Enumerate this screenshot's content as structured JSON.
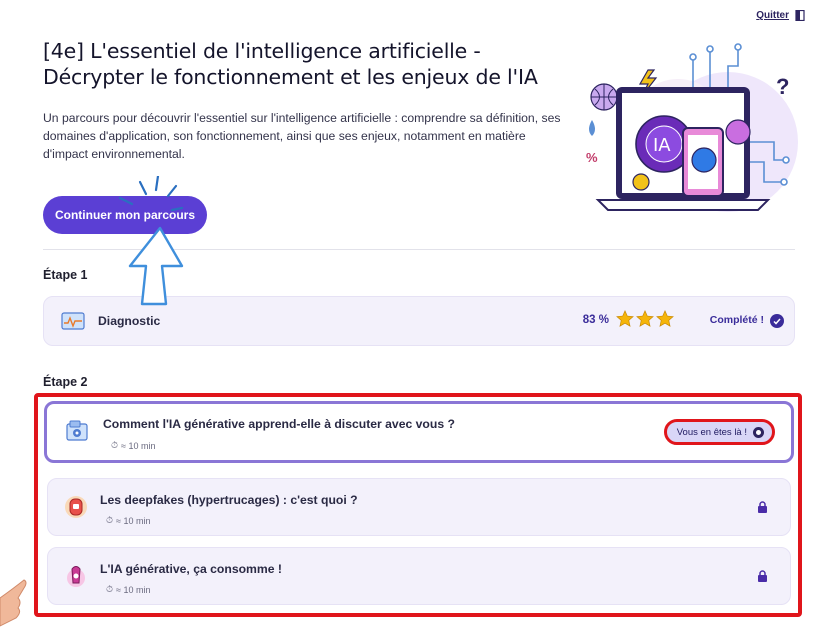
{
  "header": {
    "quit_label": "Quitter",
    "title": "[4e] L'essentiel de l'intelligence artificielle - Décrypter le fonctionnement et les enjeux de l'IA",
    "description": "Un parcours pour découvrir l'essentiel sur l'intelligence artificielle : comprendre sa définition, ses domaines d'application, son fonctionnement, ainsi que ses enjeux, notamment en matière d'impact environnemental.",
    "cta_label": "Continuer mon parcours",
    "hero_badge_text": "IA"
  },
  "steps": [
    {
      "label": "Étape 1",
      "items": [
        {
          "title": "Diagnostic",
          "icon": "diagnostic-icon",
          "score": "83 %",
          "stars_filled": 3,
          "stars_total": 3,
          "status": "Complété !"
        }
      ]
    },
    {
      "label": "Étape 2",
      "items": [
        {
          "title": "Comment l'IA générative apprend-elle à discuter avec vous ?",
          "duration": "≈ 10 min",
          "icon": "chat-robot-icon",
          "status": "Vous en êtes là !",
          "locked": false
        },
        {
          "title": "Les deepfakes (hypertrucages) : c'est quoi ?",
          "duration": "≈ 10 min",
          "icon": "deepfake-icon",
          "locked": true
        },
        {
          "title": "L'IA générative, ça consomme !",
          "duration": "≈ 10 min",
          "icon": "consumption-icon",
          "locked": true
        }
      ]
    }
  ],
  "colors": {
    "accent": "#5b3fd4",
    "highlight_red": "#e0151b",
    "card_bg": "#f3f1fb",
    "current_border": "#8a76d6",
    "star": "#f5b50a"
  }
}
